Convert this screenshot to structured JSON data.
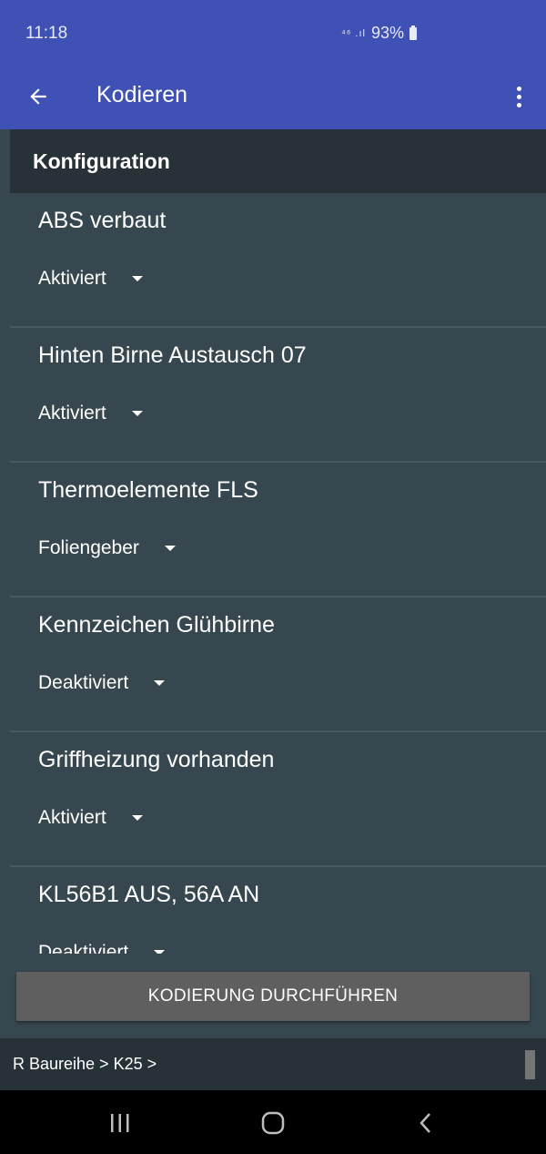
{
  "status_bar": {
    "time": "11:18",
    "signal": "⁴⁶ .ıl",
    "battery": "93%"
  },
  "app_bar": {
    "title": "Kodieren"
  },
  "section": {
    "title": "Konfiguration"
  },
  "items": [
    {
      "label": "ABS verbaut",
      "value": "Aktiviert"
    },
    {
      "label": "Hinten Birne Austausch 07",
      "value": "Aktiviert"
    },
    {
      "label": "Thermoelemente FLS",
      "value": "Foliengeber"
    },
    {
      "label": "Kennzeichen Glühbirne",
      "value": "Deaktiviert"
    },
    {
      "label": "Griffheizung vorhanden",
      "value": "Aktiviert"
    },
    {
      "label": "KL56B1 AUS, 56A AN",
      "value": "Deaktiviert"
    }
  ],
  "action_button": {
    "label": "KODIERUNG DURCHFÜHREN"
  },
  "breadcrumb": {
    "text": "R Baureihe > K25 >"
  },
  "icons": {
    "back": "arrow-left-icon",
    "menu": "more-vert-icon",
    "dropdown": "caret-down-icon",
    "nav_recents": "recents-icon",
    "nav_home": "home-icon",
    "nav_back": "back-chevron-icon"
  },
  "colors": {
    "primary": "#3f51b5",
    "background": "#37474f",
    "header": "#263238",
    "button": "#5f5f5f"
  }
}
